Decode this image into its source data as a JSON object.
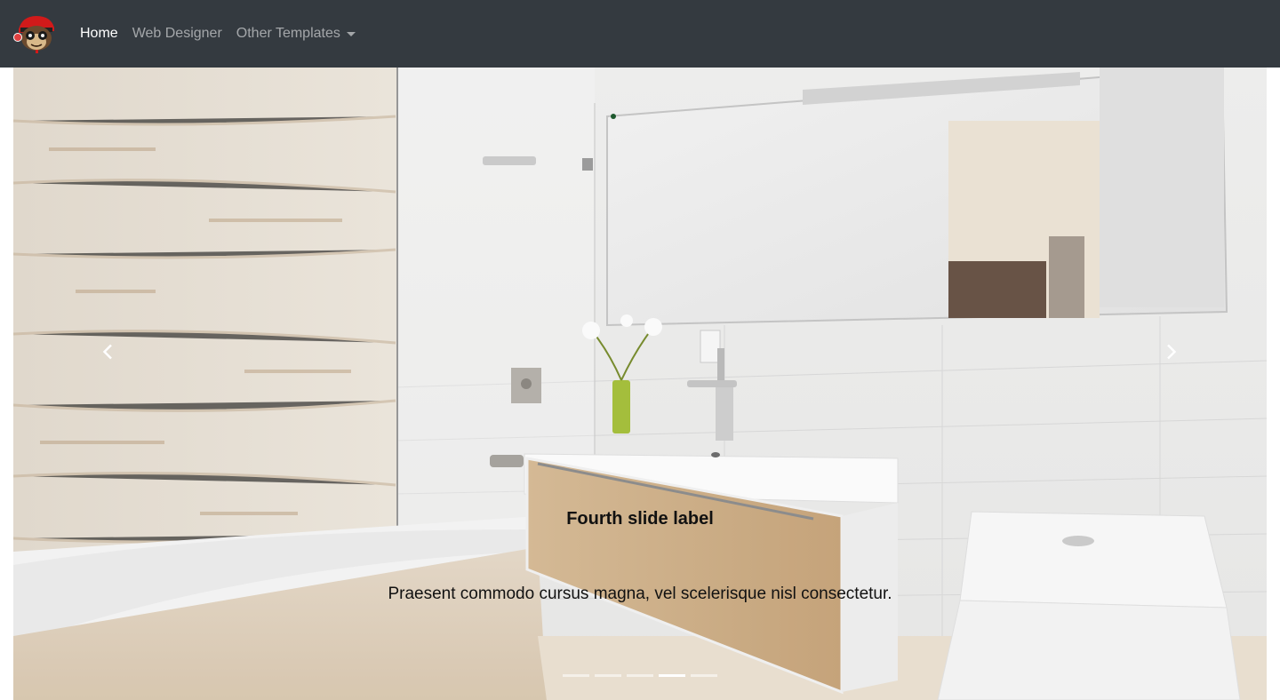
{
  "navbar": {
    "logo_icon": "monkey-mascot-logo",
    "links": [
      {
        "label": "Home",
        "active": true
      },
      {
        "label": "Web Designer",
        "active": false
      },
      {
        "label": "Other Templates",
        "active": false,
        "dropdown": true
      }
    ],
    "background": "#343a40"
  },
  "carousel": {
    "active_slide": 4,
    "slide_count": 5,
    "caption": {
      "title": "Fourth slide label",
      "text": "Praesent commodo cursus magna, vel scelerisque nisl consectetur."
    },
    "prev_icon": "chevron-left-icon",
    "next_icon": "chevron-right-icon",
    "indicators": [
      {
        "active": false
      },
      {
        "active": false
      },
      {
        "active": false
      },
      {
        "active": true
      },
      {
        "active": false
      }
    ]
  }
}
